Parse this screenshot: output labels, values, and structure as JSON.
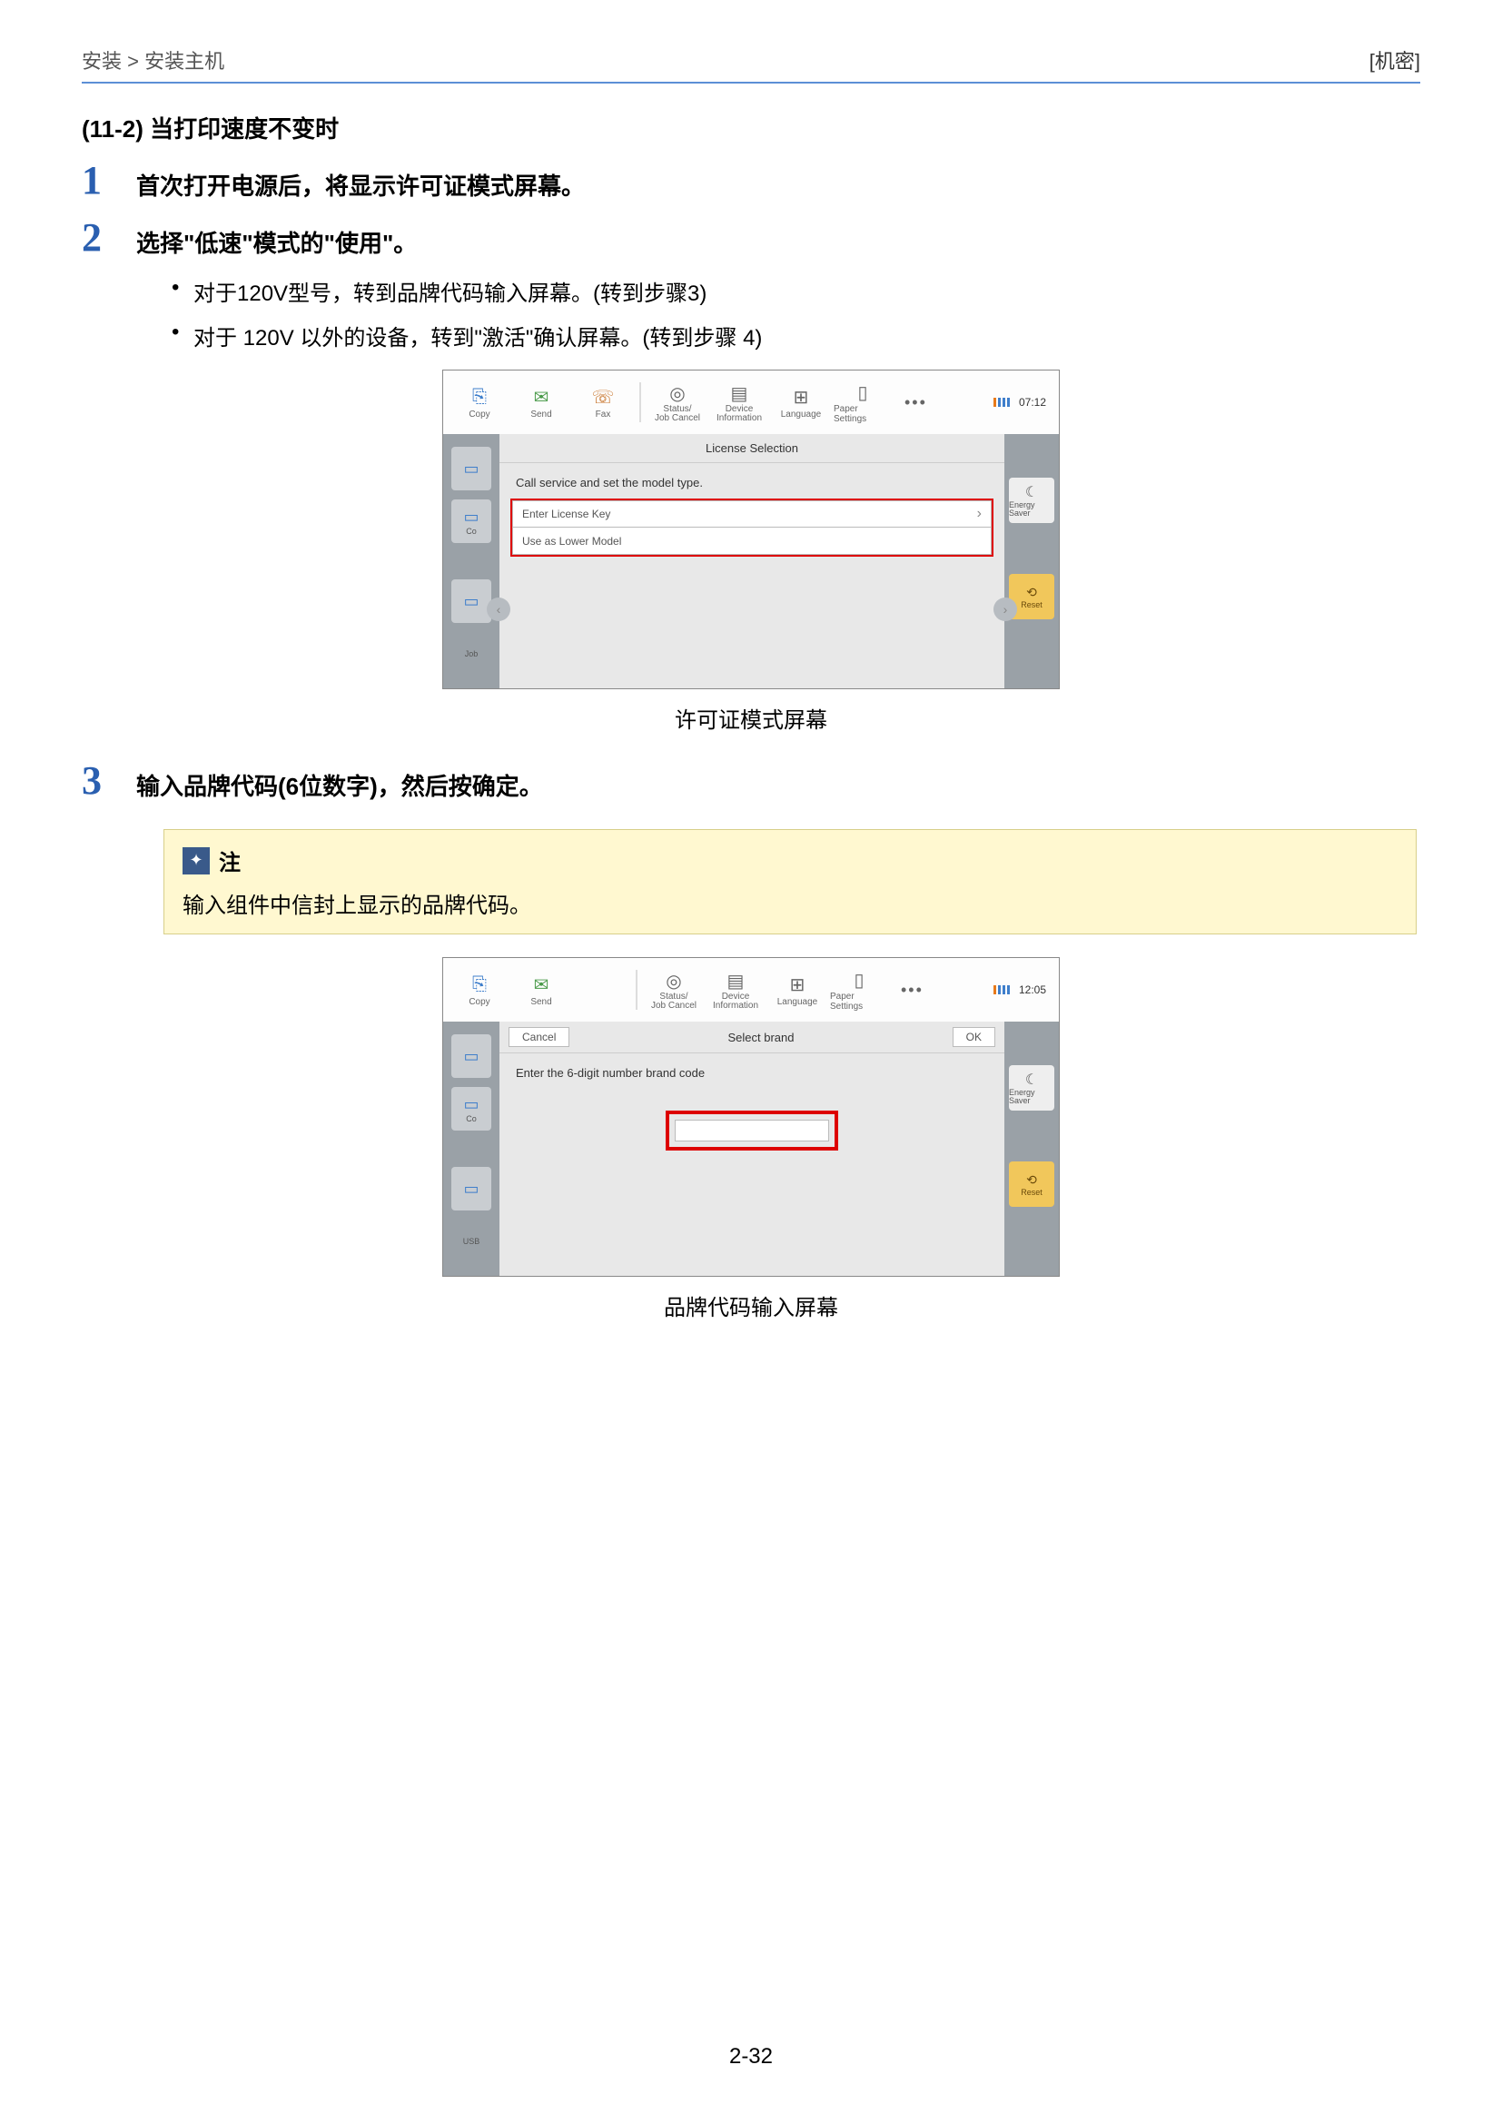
{
  "header": {
    "breadcrumb": "安装 > 安装主机",
    "confidential": "[机密]"
  },
  "section_title": "(11-2) 当打印速度不变时",
  "steps": [
    {
      "num": "1",
      "text": "首次打开电源后，将显示许可证模式屏幕。"
    },
    {
      "num": "2",
      "text": "选择\"低速\"模式的\"使用\"。"
    },
    {
      "num": "3",
      "text": "输入品牌代码(6位数字)，然后按确定。"
    }
  ],
  "bullets_step2": [
    "对于120V型号，转到品牌代码输入屏幕。(转到步骤3)",
    "对于 120V 以外的设备，转到\"激活\"确认屏幕。(转到步骤 4)"
  ],
  "figure1": {
    "caption": "许可证模式屏幕",
    "time": "07:12",
    "topbar": {
      "copy": "Copy",
      "send": "Send",
      "fax": "Fax",
      "status": "Status/\nJob Cancel",
      "device": "Device\nInformation",
      "language": "Language",
      "paper": "Paper Settings"
    },
    "dialog_title": "License Selection",
    "dialog_text": "Call service and set the model type.",
    "row1": "Enter License Key",
    "row2": "Use as Lower Model",
    "left_items": {
      "co": "Co",
      "job": "Job"
    },
    "right": {
      "energy": "Energy Saver",
      "reset": "Reset"
    }
  },
  "note": {
    "label": "注",
    "body": "输入组件中信封上显示的品牌代码。"
  },
  "figure2": {
    "caption": "品牌代码输入屏幕",
    "time": "12:05",
    "topbar": {
      "copy": "Copy",
      "send": "Send",
      "status": "Status/\nJob Cancel",
      "device": "Device\nInformation",
      "language": "Language",
      "paper": "Paper Settings"
    },
    "cancel": "Cancel",
    "title": "Select brand",
    "ok": "OK",
    "instruction": "Enter the 6-digit number brand code",
    "left_items": {
      "co": "Co",
      "usb": "USB"
    },
    "right": {
      "energy": "Energy Saver",
      "reset": "Reset"
    }
  },
  "page_number": "2-32"
}
